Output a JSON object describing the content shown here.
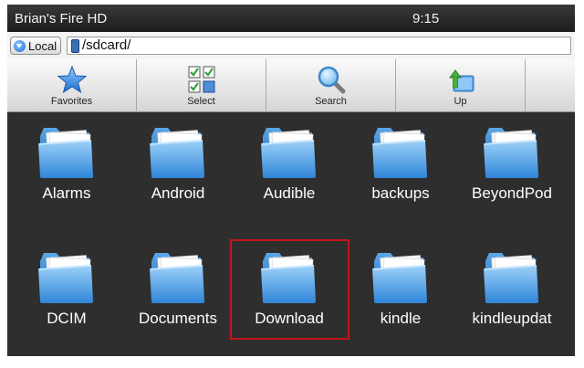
{
  "statusbar": {
    "device_name": "Brian's Fire HD",
    "time": "9:15"
  },
  "addressbar": {
    "location_button": "Local",
    "path": "/sdcard/"
  },
  "toolbar": {
    "items": [
      {
        "label": "Favorites",
        "icon": "star-icon"
      },
      {
        "label": "Select",
        "icon": "select-grid-icon"
      },
      {
        "label": "Search",
        "icon": "magnifier-icon"
      },
      {
        "label": "Up",
        "icon": "up-folder-icon"
      }
    ]
  },
  "folders": [
    {
      "name": "Alarms"
    },
    {
      "name": "Android"
    },
    {
      "name": "Audible"
    },
    {
      "name": "backups"
    },
    {
      "name": "BeyondPod"
    },
    {
      "name": "DCIM"
    },
    {
      "name": "Documents"
    },
    {
      "name": "Download"
    },
    {
      "name": "kindle"
    },
    {
      "name": "kindleupdat"
    }
  ],
  "highlighted_folder": "Download",
  "colors": {
    "folder_blue": "#4a9fe6",
    "highlight_border": "#c6141b",
    "background": "#2e2e2e"
  }
}
